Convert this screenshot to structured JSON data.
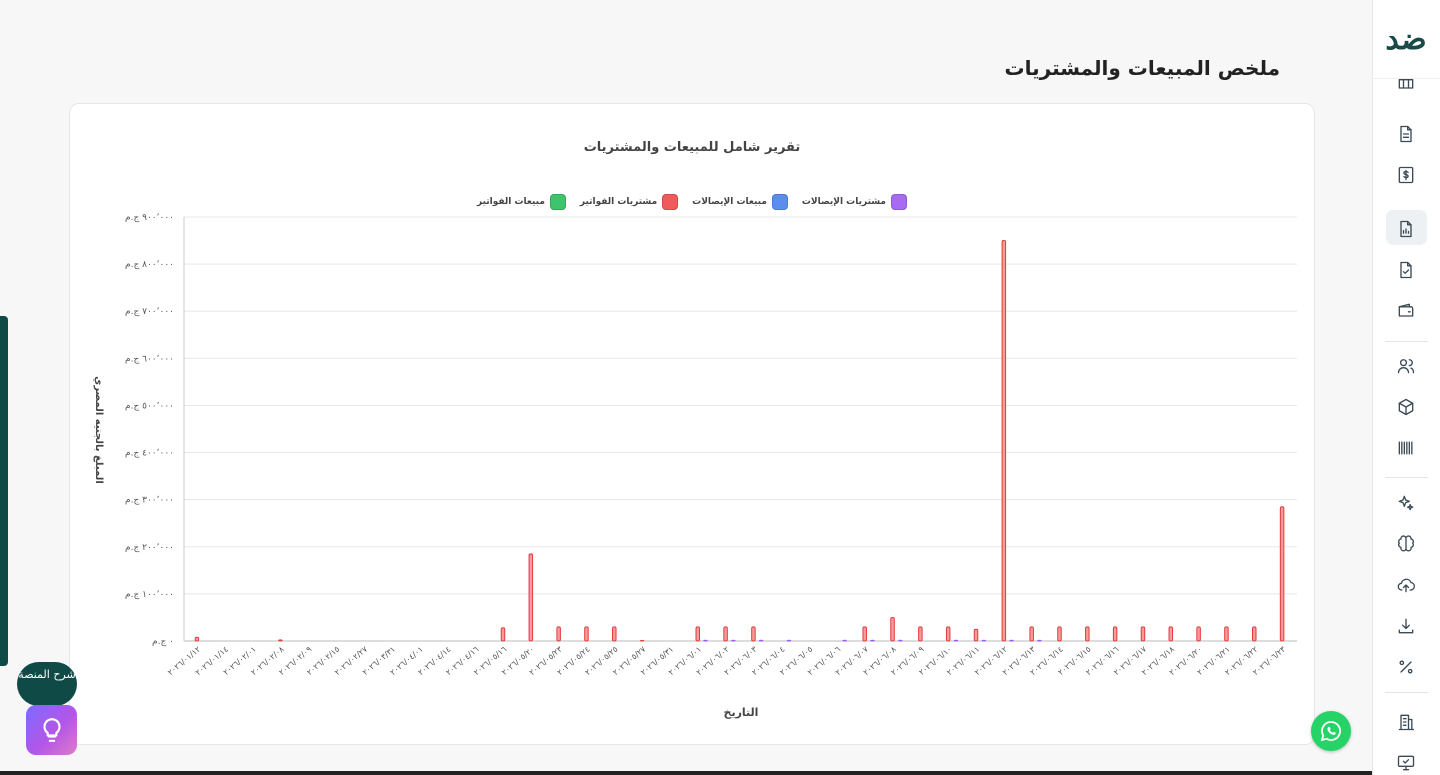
{
  "page": {
    "title": "ملخص المبيعات والمشتريات"
  },
  "chart": {
    "title": "تقرير شامل للمبيعات والمشتريات",
    "legend": [
      {
        "label": "مبيعات الفواتير",
        "color": "#3ec46d"
      },
      {
        "label": "مشتريات الفواتير",
        "color": "#f05a5a"
      },
      {
        "label": "مبيعات الإيصالات",
        "color": "#5b8def"
      },
      {
        "label": "مشتريات الإيصالات",
        "color": "#a66bf0"
      }
    ],
    "ylabel": "المبلغ بالجنيه المصري",
    "xlabel": "التاريخ"
  },
  "chart_data": {
    "type": "bar",
    "title": "تقرير شامل للمبيعات والمشتريات",
    "xlabel": "التاريخ",
    "ylabel": "المبلغ بالجنيه المصري",
    "ylim": [
      0,
      900000
    ],
    "yticks": [
      0,
      100000,
      200000,
      300000,
      400000,
      500000,
      600000,
      700000,
      800000,
      900000
    ],
    "ytick_labels": [
      "٠ ج.م",
      "١٠٠٬٠٠٠ ج.م",
      "٢٠٠٬٠٠٠ ج.م",
      "٣٠٠٬٠٠٠ ج.م",
      "٤٠٠٬٠٠٠ ج.م",
      "٥٠٠٬٠٠٠ ج.م",
      "٦٠٠٬٠٠٠ ج.م",
      "٧٠٠٬٠٠٠ ج.م",
      "٨٠٠٬٠٠٠ ج.م",
      "٩٠٠٬٠٠٠ ج.م"
    ],
    "grid": true,
    "legend_position": "top",
    "categories": [
      "٢٠٢٦/٠١/١٢",
      "٢٠٢٦/٠١/١٤",
      "٢٠٢٦/٠٢/٠١",
      "٢٠٢٦/٠٢/٠٨",
      "٢٠٢٦/٠٢/٠٩",
      "٢٠٢٦/٠٢/١٥",
      "٢٠٢٦/٠٢/٢٧",
      "٢٠٢٦/٠٣/٣١",
      "٢٠٢٦/٠٤/٠١",
      "٢٠٢٦/٠٤/١٤",
      "٢٠٢٦/٠٤/١٦",
      "٢٠٢٦/٠٥/١٦",
      "٢٠٢٦/٠٥/٢٠",
      "٢٠٢٦/٠٥/٢٣",
      "٢٠٢٦/٠٥/٢٤",
      "٢٠٢٦/٠٥/٢٥",
      "٢٠٢٦/٠٥/٢٧",
      "٢٠٢٦/٠٥/٣١",
      "٢٠٢٦/٠٦/٠١",
      "٢٠٢٦/٠٦/٠٢",
      "٢٠٢٦/٠٦/٠٣",
      "٢٠٢٦/٠٦/٠٤",
      "٢٠٢٦/٠٦/٠٥",
      "٢٠٢٦/٠٦/٠٦",
      "٢٠٢٦/٠٦/٠٧",
      "٢٠٢٦/٠٦/٠٨",
      "٢٠٢٦/٠٦/٠٩",
      "٢٠٢٦/٠٦/١٠",
      "٢٠٢٦/٠٦/١١",
      "٢٠٢٦/٠٦/١٢",
      "٢٠٢٦/٠٦/١٣",
      "٢٠٢٦/٠٦/١٤",
      "٢٠٢٦/٠٦/١٥",
      "٢٠٢٦/٠٦/١٦",
      "٢٠٢٦/٠٦/١٧",
      "٢٠٢٦/٠٦/١٨",
      "٢٠٢٦/٠٦/٢٠",
      "٢٠٢٦/٠٦/٢١",
      "٢٠٢٦/٠٦/٢٢",
      "٢٠٢٦/٠٦/٢٣"
    ],
    "series": [
      {
        "name": "مبيعات الفواتير",
        "color": "#3ec46d",
        "values": [
          0,
          0,
          0,
          0,
          0,
          0,
          0,
          0,
          0,
          0,
          0,
          0,
          0,
          0,
          0,
          0,
          0,
          0,
          0,
          0,
          0,
          0,
          0,
          0,
          0,
          0,
          0,
          0,
          0,
          0,
          0,
          0,
          0,
          0,
          0,
          0,
          0,
          0,
          0,
          0
        ]
      },
      {
        "name": "مشتريات الفواتير",
        "color": "#f05a5a",
        "values": [
          8000,
          0,
          0,
          2500,
          0,
          0,
          0,
          0,
          0,
          0,
          0,
          28000,
          185000,
          30000,
          30000,
          30000,
          1000,
          0,
          30000,
          30000,
          30000,
          0,
          0,
          0,
          30000,
          50000,
          30000,
          30000,
          25000,
          850000,
          30000,
          30000,
          30000,
          30000,
          30000,
          30000,
          30000,
          30000,
          30000,
          285000
        ]
      },
      {
        "name": "مبيعات الإيصالات",
        "color": "#5b8def",
        "values": [
          0,
          0,
          0,
          0,
          0,
          0,
          0,
          0,
          0,
          0,
          0,
          0,
          0,
          0,
          0,
          0,
          0,
          0,
          0,
          0,
          0,
          0,
          0,
          0,
          0,
          0,
          0,
          0,
          0,
          0,
          0,
          0,
          0,
          0,
          0,
          0,
          0,
          0,
          0,
          0
        ]
      },
      {
        "name": "مشتريات الإيصالات",
        "color": "#a66bf0",
        "values": [
          0,
          0,
          0,
          0,
          0,
          0,
          0,
          0,
          0,
          0,
          0,
          0,
          0,
          0,
          0,
          0,
          0,
          0,
          1500,
          1500,
          1500,
          1500,
          0,
          1500,
          1500,
          1500,
          0,
          1500,
          1500,
          1500,
          1500,
          0,
          0,
          0,
          0,
          0,
          0,
          0,
          0,
          0
        ]
      }
    ]
  },
  "help": {
    "label": "شرح المنصة"
  },
  "sidebar": {
    "logo": "ضد",
    "items": [
      "table-icon",
      "document-icon",
      "invoice-dollar-icon",
      "report-chart-icon",
      "file-check-icon",
      "wallet-icon",
      "users-icon",
      "box-icon",
      "barcode-icon",
      "sparkles-icon",
      "brain-icon",
      "upload-cloud-icon",
      "download-icon",
      "percent-icon",
      "building-icon",
      "monitor-check-icon"
    ]
  }
}
